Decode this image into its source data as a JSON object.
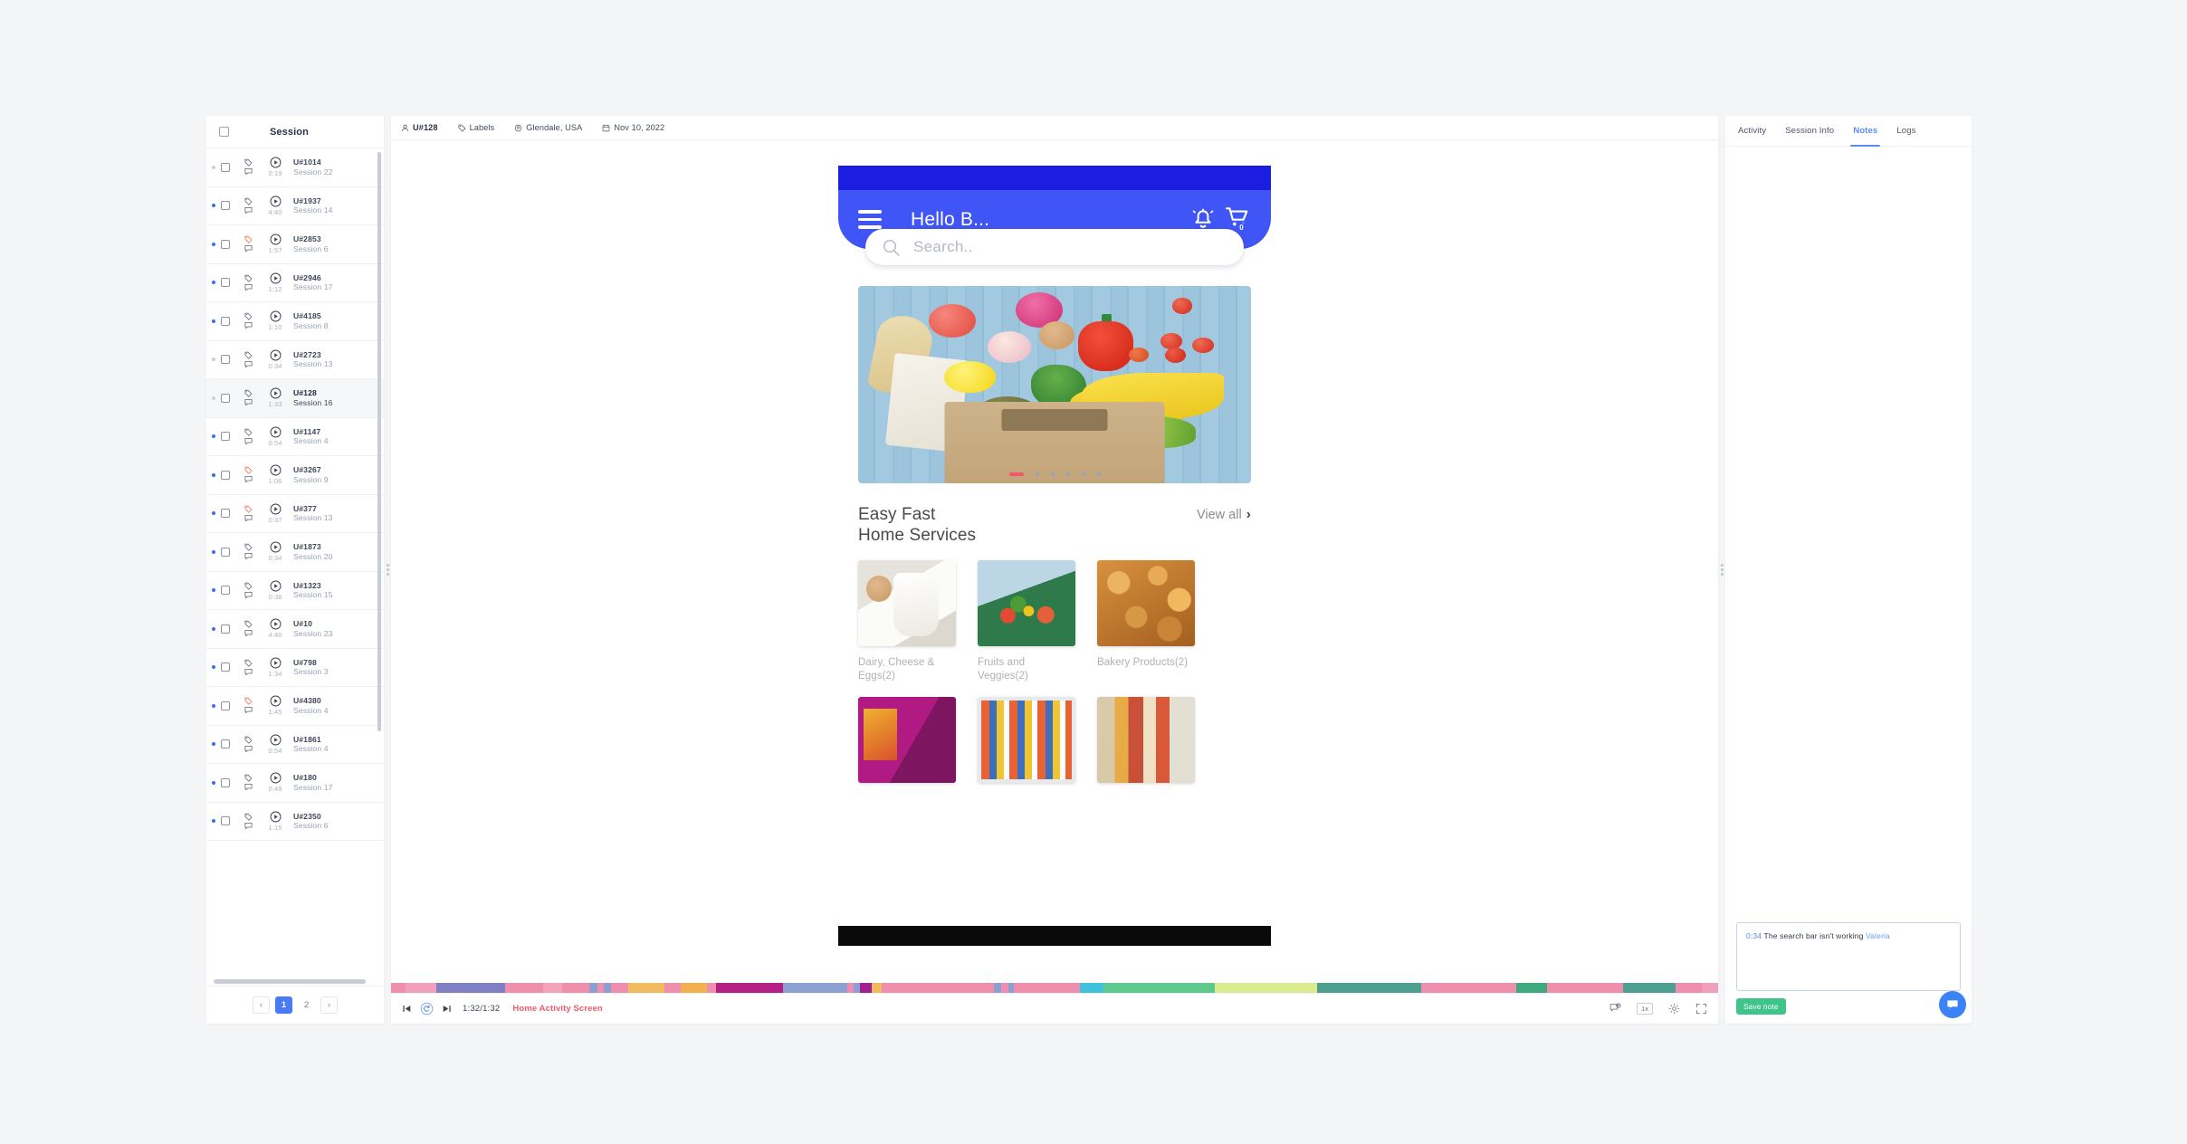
{
  "sessions_panel": {
    "header_title": "Session",
    "rows": [
      {
        "user": "U#1014",
        "session": "Session 22",
        "time": "0:19",
        "tag_flag": false,
        "dot": "muted"
      },
      {
        "user": "U#1937",
        "session": "Session 14",
        "time": "4:40",
        "tag_flag": false,
        "dot": "active"
      },
      {
        "user": "U#2853",
        "session": "Session 6",
        "time": "1:57",
        "tag_flag": true,
        "dot": "active"
      },
      {
        "user": "U#2946",
        "session": "Session 17",
        "time": "1:12",
        "tag_flag": false,
        "dot": "active"
      },
      {
        "user": "U#4185",
        "session": "Session 8",
        "time": "1:10",
        "tag_flag": false,
        "dot": "active"
      },
      {
        "user": "U#2723",
        "session": "Session 13",
        "time": "0:34",
        "tag_flag": false,
        "dot": "muted"
      },
      {
        "user": "U#128",
        "session": "Session 16",
        "time": "1:33",
        "tag_flag": false,
        "dot": "muted",
        "selected": true
      },
      {
        "user": "U#1147",
        "session": "Session 4",
        "time": "0:54",
        "tag_flag": false,
        "dot": "active"
      },
      {
        "user": "U#3267",
        "session": "Session 9",
        "time": "1:06",
        "tag_flag": true,
        "dot": "active"
      },
      {
        "user": "U#377",
        "session": "Session 13",
        "time": "0:37",
        "tag_flag": true,
        "dot": "active"
      },
      {
        "user": "U#1873",
        "session": "Session 20",
        "time": "0:34",
        "tag_flag": false,
        "dot": "active"
      },
      {
        "user": "U#1323",
        "session": "Session 15",
        "time": "0:38",
        "tag_flag": false,
        "dot": "active"
      },
      {
        "user": "U#10",
        "session": "Session 23",
        "time": "4:40",
        "tag_flag": false,
        "dot": "active"
      },
      {
        "user": "U#798",
        "session": "Session 3",
        "time": "1:34",
        "tag_flag": false,
        "dot": "active"
      },
      {
        "user": "U#4380",
        "session": "Session 4",
        "time": "1:45",
        "tag_flag": true,
        "dot": "active"
      },
      {
        "user": "U#1861",
        "session": "Session 4",
        "time": "0:54",
        "tag_flag": false,
        "dot": "active"
      },
      {
        "user": "U#180",
        "session": "Session 17",
        "time": "0:49",
        "tag_flag": false,
        "dot": "active"
      },
      {
        "user": "U#2350",
        "session": "Session 6",
        "time": "1:15",
        "tag_flag": false,
        "dot": "active"
      }
    ],
    "pagination": {
      "prev": "‹",
      "next": "›",
      "pages": [
        "1",
        "2"
      ],
      "current": "1"
    }
  },
  "player_header": {
    "user": "U#128",
    "labels": "Labels",
    "location": "Glendale, USA",
    "date": "Nov 10, 2022"
  },
  "phone": {
    "greeting": "Hello B...",
    "search_placeholder": "Search..",
    "cart_count": "0",
    "section_title_line1": "Easy Fast",
    "section_title_line2": "Home Services",
    "view_all": "View all",
    "categories_row1": [
      {
        "label": "Dairy, Cheese & Eggs(2)",
        "thumb": "th-dairy"
      },
      {
        "label": "Fruits and Veggies(2)",
        "thumb": "th-veg"
      },
      {
        "label": "Bakery Products(2)",
        "thumb": "th-bakery"
      }
    ],
    "categories_row2": [
      {
        "label": "",
        "thumb": "th-snack1"
      },
      {
        "label": "",
        "thumb": "th-snack2"
      },
      {
        "label": "",
        "thumb": "th-snack3"
      }
    ]
  },
  "player_controls": {
    "current_time": "1:32",
    "total_time": "1:32",
    "time_display": "1:32/1:32",
    "screen_name": "Home Activity Screen",
    "speed": "1x"
  },
  "timeline": {
    "segments": [
      {
        "color": "#ef8fae",
        "w": 1.2
      },
      {
        "color": "#f0a0bb",
        "w": 2.6
      },
      {
        "color": "#7f7fc4",
        "w": 5.8
      },
      {
        "color": "#ef8fae",
        "w": 3.2
      },
      {
        "color": "#f2a4bd",
        "w": 1.6
      },
      {
        "color": "#ef8fae",
        "w": 2.3
      },
      {
        "color": "#8b9fd0",
        "w": 0.7
      },
      {
        "color": "#ef8fae",
        "w": 0.5
      },
      {
        "color": "#8b9fd0",
        "w": 0.6
      },
      {
        "color": "#ef8fae",
        "w": 1.5
      },
      {
        "color": "#f0bb5e",
        "w": 3.0
      },
      {
        "color": "#ef8fae",
        "w": 1.4
      },
      {
        "color": "#f2b150",
        "w": 2.2
      },
      {
        "color": "#ef8fae",
        "w": 0.8
      },
      {
        "color": "#b31f82",
        "w": 5.6
      },
      {
        "color": "#8b9fd0",
        "w": 5.4
      },
      {
        "color": "#ef8fae",
        "w": 0.6
      },
      {
        "color": "#8b9fd0",
        "w": 0.5
      },
      {
        "color": "#a12090",
        "w": 1.0
      },
      {
        "color": "#f0bb5e",
        "w": 0.8
      },
      {
        "color": "#ef8fae",
        "w": 9.5
      },
      {
        "color": "#8b9fd0",
        "w": 0.6
      },
      {
        "color": "#ef8fae",
        "w": 0.6
      },
      {
        "color": "#8b9fd0",
        "w": 0.5
      },
      {
        "color": "#ef8fae",
        "w": 5.5
      },
      {
        "color": "#3fc0dd",
        "w": 2.0
      },
      {
        "color": "#5dc98f",
        "w": 9.4
      },
      {
        "color": "#dbec8e",
        "w": 8.6
      },
      {
        "color": "#4d9f8f",
        "w": 8.8
      },
      {
        "color": "#ef8fae",
        "w": 8.0
      },
      {
        "color": "#3fa87c",
        "w": 2.6
      },
      {
        "color": "#ef8fae",
        "w": 6.4
      },
      {
        "color": "#4d9f8f",
        "w": 4.4
      },
      {
        "color": "#ef8fae",
        "w": 2.2
      },
      {
        "color": "#f0a0bb",
        "w": 1.4
      }
    ]
  },
  "notes_panel": {
    "tabs": [
      {
        "label": "Activity",
        "active": false
      },
      {
        "label": "Session Info",
        "active": false
      },
      {
        "label": "Notes",
        "active": true
      },
      {
        "label": "Logs",
        "active": false
      }
    ],
    "note": {
      "timestamp": "0:34",
      "text": "The search bar isn't working",
      "author": "Valeria"
    },
    "save_label": "Save note"
  },
  "colors": {
    "accent_blue": "#4a7bf7",
    "app_blue": "#4055f5",
    "status_blue": "#1b1ee0",
    "screen_pink": "#f05a6e",
    "save_green": "#3fc48a"
  }
}
